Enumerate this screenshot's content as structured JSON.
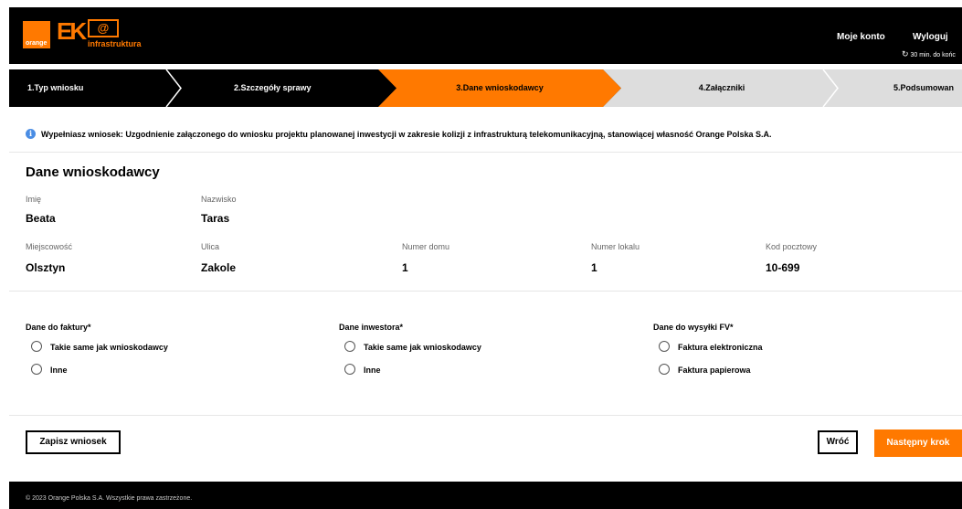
{
  "header": {
    "logo_text": "orange",
    "ek_text": "EK",
    "ek_envelope": "@",
    "ek_sub": "infrastruktura",
    "my_account": "Moje konto",
    "logout": "Wyloguj",
    "timer_icon": "refresh-icon",
    "timer_text": "30 min. do końc"
  },
  "stepper": {
    "steps": [
      {
        "label": "1.Typ wniosku",
        "state": "done"
      },
      {
        "label": "2.Szczegóły sprawy",
        "state": "done"
      },
      {
        "label": "3.Dane wnioskodawcy",
        "state": "active"
      },
      {
        "label": "4.Załączniki",
        "state": "future"
      },
      {
        "label": "5.Podsumowan",
        "state": "future"
      }
    ]
  },
  "info": {
    "icon": "info-icon",
    "text": "Wypełniasz wniosek: Uzgodnienie załączonego do wniosku projektu planowanej inwestycji w zakresie kolizji z infrastrukturą telekomunikacyjną, stanowiącej własność Orange Polska S.A."
  },
  "applicant": {
    "title": "Dane wnioskodawcy",
    "first_name_label": "Imię",
    "first_name": "Beata",
    "last_name_label": "Nazwisko",
    "last_name": "Taras",
    "city_label": "Miejscowość",
    "city": "Olsztyn",
    "street_label": "Ulica",
    "street": "Zakole",
    "house_label": "Numer domu",
    "house": "1",
    "apartment_label": "Numer lokalu",
    "apartment": "1",
    "postal_label": "Kod pocztowy",
    "postal": "10-699"
  },
  "groups": {
    "invoice": {
      "title": "Dane do faktury*",
      "options": [
        "Takie same jak wnioskodawcy",
        "Inne"
      ]
    },
    "investor": {
      "title": "Dane inwestora*",
      "options": [
        "Takie same jak wnioskodawcy",
        "Inne"
      ]
    },
    "shipping": {
      "title": "Dane do wysyłki FV*",
      "options": [
        "Faktura elektroniczna",
        "Faktura papierowa"
      ]
    }
  },
  "actions": {
    "save": "Zapisz wniosek",
    "back": "Wróć",
    "next": "Następny krok"
  },
  "footer": {
    "copyright": "© 2023 Orange Polska S.A. Wszystkie prawa zastrzeżone."
  },
  "colors": {
    "accent": "#ff7900",
    "header_bg": "#000000",
    "inactive_step": "#dddddd",
    "info": "#4a8de4"
  }
}
